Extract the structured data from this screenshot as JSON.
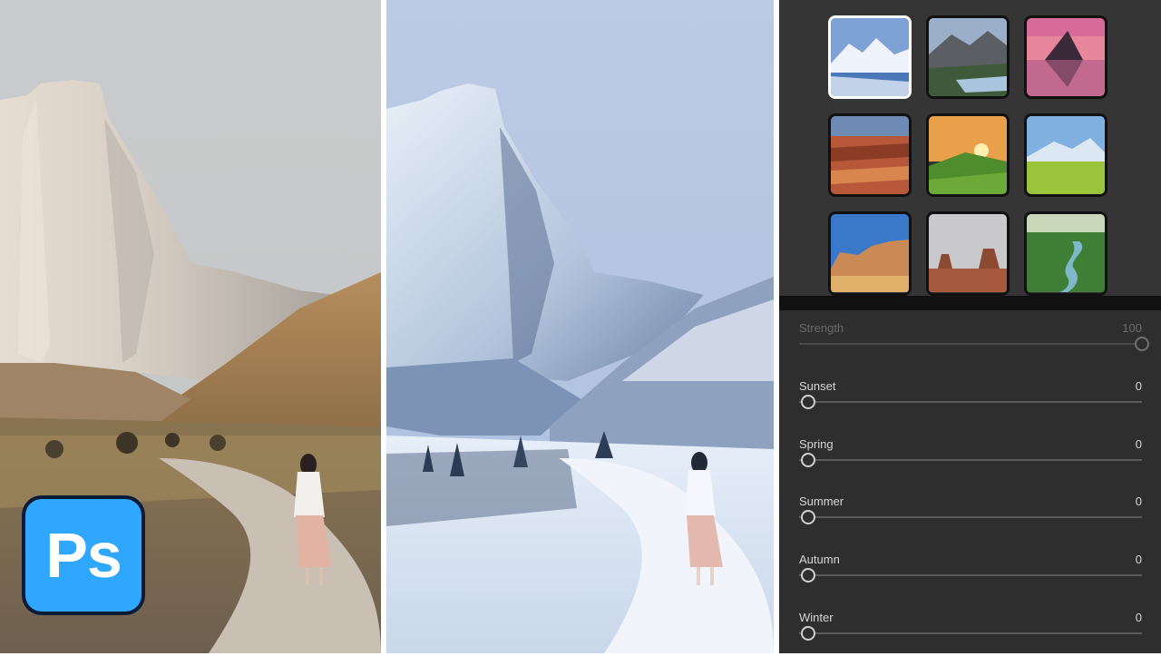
{
  "app": {
    "logo_text": "Ps",
    "logo_color": "#2fa7ff"
  },
  "images": {
    "before": "landscape-original",
    "after": "landscape-winter-applied"
  },
  "presets": [
    {
      "name": "snowy-mountain-lake",
      "selected": true
    },
    {
      "name": "mountain-valley-lake",
      "selected": false
    },
    {
      "name": "sunset-mountain-reflection",
      "selected": false
    },
    {
      "name": "red-canyon",
      "selected": false
    },
    {
      "name": "sunrise-green-hills",
      "selected": false
    },
    {
      "name": "spring-meadow-mountains",
      "selected": false
    },
    {
      "name": "desert-rock-formations",
      "selected": false
    },
    {
      "name": "desert-buttes",
      "selected": false
    },
    {
      "name": "green-river-valley",
      "selected": false
    }
  ],
  "sliders": [
    {
      "label": "Strength",
      "value": "100",
      "level": 1.0,
      "disabled": true
    },
    {
      "label": "Sunset",
      "value": "0",
      "level": 0.0,
      "disabled": false
    },
    {
      "label": "Spring",
      "value": "0",
      "level": 0.0,
      "disabled": false
    },
    {
      "label": "Summer",
      "value": "0",
      "level": 0.0,
      "disabled": false
    },
    {
      "label": "Autumn",
      "value": "0",
      "level": 0.0,
      "disabled": false
    },
    {
      "label": "Winter",
      "value": "0",
      "level": 0.0,
      "disabled": false
    }
  ]
}
